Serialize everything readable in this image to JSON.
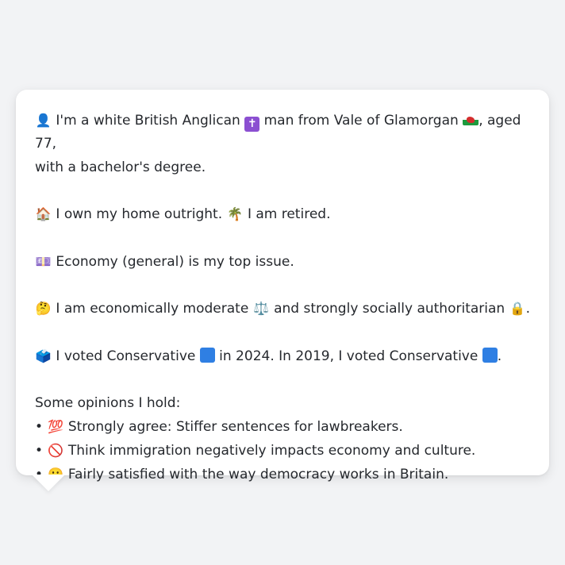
{
  "profile": {
    "line1_a": "I'm a white British Anglican",
    "line1_b": "man from Vale of Glamorgan",
    "line1_c": ", aged 77,",
    "line2": "with a bachelor's degree.",
    "home_a": "I own my home outright.",
    "home_b": "I am retired.",
    "issue": "Economy (general) is my top issue.",
    "ideology_a": "I am economically moderate",
    "ideology_b": "and strongly socially authoritarian",
    "ideology_c": ".",
    "vote_a": "I voted Conservative",
    "vote_b": "in 2024. In 2019, I voted Conservative",
    "vote_c": ".",
    "opinions_heading": "Some opinions I hold:",
    "opinions": [
      {
        "bullet": "•",
        "text": "Strongly agree: Stiffer sentences for lawbreakers."
      },
      {
        "bullet": "•",
        "text": "Think immigration negatively impacts economy and culture."
      },
      {
        "bullet": "•",
        "text": "Fairly satisfied with the way democracy works in Britain."
      }
    ]
  },
  "icons": {
    "person": "👤",
    "cross": "✝",
    "house": "🏠",
    "palm": "🌴",
    "money": "💷",
    "thinking": "🤔",
    "scales": "⚖️",
    "lock": "🔒",
    "ballot": "🗳️",
    "hundred": "💯",
    "no_entry": "🚫",
    "smile": "🙂"
  },
  "colors": {
    "background": "#f2f3f5",
    "bubble": "#ffffff",
    "text": "#25282d",
    "conservative_blue": "#2f7fe3",
    "cross_purple": "#8b4fd1"
  }
}
